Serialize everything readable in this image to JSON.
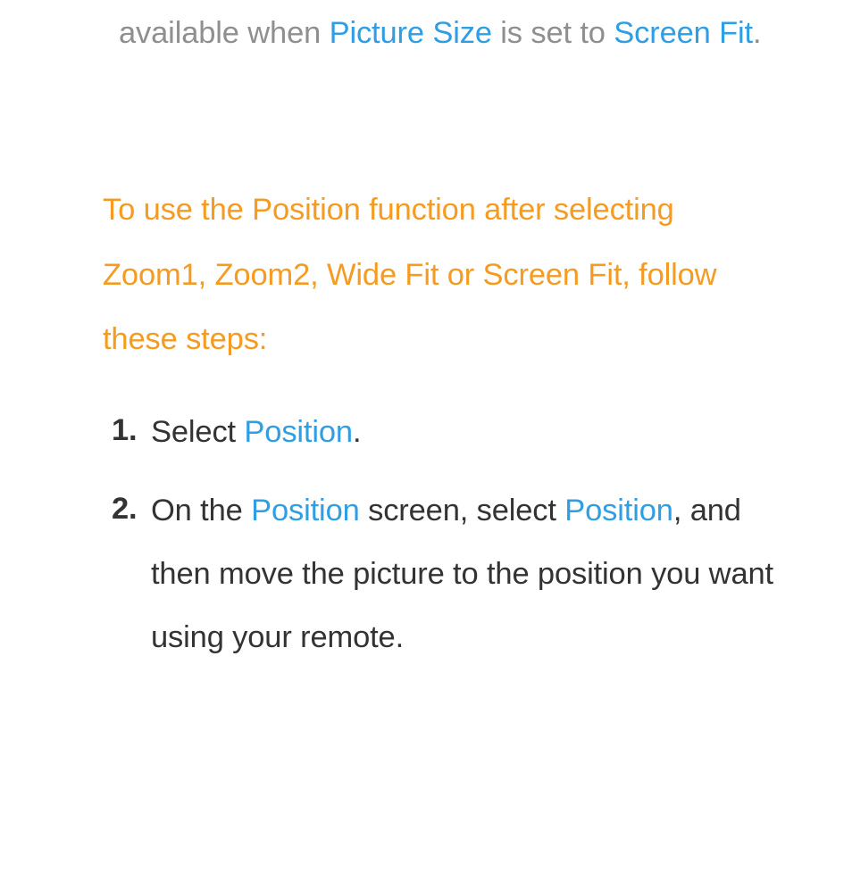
{
  "para1": {
    "t1": "available when ",
    "t2": "Picture Size",
    "t3": " is set to ",
    "t4": "Screen Fit",
    "t5": "."
  },
  "para2": {
    "text": "To use the Position function after selecting Zoom1, Zoom2, Wide Fit or Screen Fit, follow these steps:"
  },
  "steps": [
    {
      "num": "1.",
      "parts": [
        {
          "text": "Select ",
          "cls": "black"
        },
        {
          "text": "Position",
          "cls": "blue"
        },
        {
          "text": ".",
          "cls": "black"
        }
      ]
    },
    {
      "num": "2.",
      "parts": [
        {
          "text": "On the ",
          "cls": "black"
        },
        {
          "text": "Position",
          "cls": "blue"
        },
        {
          "text": " screen, select ",
          "cls": "black"
        },
        {
          "text": "Position",
          "cls": "blue"
        },
        {
          "text": ", and then move the picture to the position you want using your remote.",
          "cls": "black"
        }
      ]
    }
  ]
}
